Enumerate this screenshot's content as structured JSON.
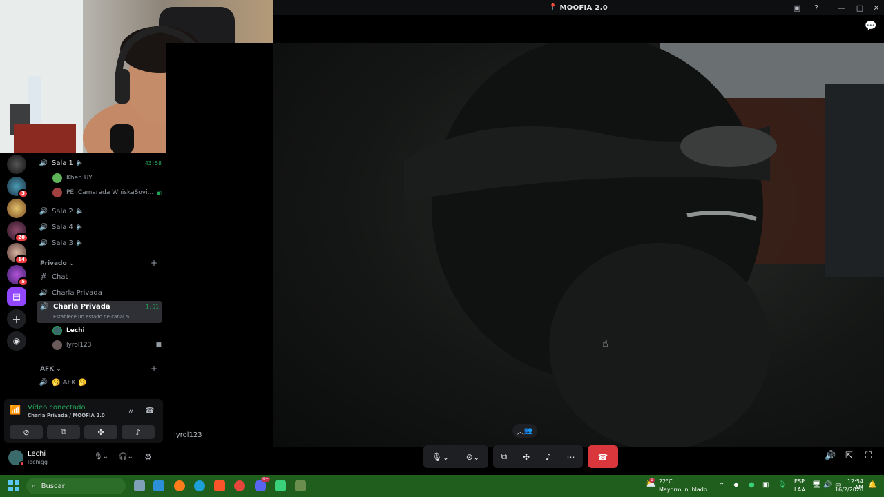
{
  "window": {
    "title": "MOOFIA 2.0"
  },
  "servers": [
    {
      "name": "server-1",
      "badge": ""
    },
    {
      "name": "server-2",
      "badge": "3"
    },
    {
      "name": "server-3",
      "badge": ""
    },
    {
      "name": "server-4",
      "badge": "20"
    },
    {
      "name": "server-5",
      "badge": "14"
    },
    {
      "name": "server-6",
      "badge": "5"
    },
    {
      "name": "twitch-server",
      "badge": ""
    }
  ],
  "channels": {
    "sala1": {
      "label": "Sala 1",
      "timer": "43:58",
      "members": [
        "Khen UY",
        "PE. Camarada WhiskaSovi..."
      ]
    },
    "sala2": {
      "label": "Sala 2"
    },
    "sala4": {
      "label": "Sala 4"
    },
    "sala3": {
      "label": "Sala 3"
    },
    "category_privado": "Privado",
    "chat": {
      "label": "Chat"
    },
    "charla1": {
      "label": "Charla Privada"
    },
    "charla2": {
      "label": "Charla Privada",
      "timer": "1:51",
      "status": "Establece un estado de canal",
      "members": [
        "Lechi",
        "lyrol123"
      ]
    },
    "category_afk": "AFK",
    "afk": {
      "label": "🥱 AFK 🥱"
    }
  },
  "voice": {
    "status": "Vídeo conectado",
    "channel": "Charla Privada / MOOFIA 2.0"
  },
  "user": {
    "name": "Lechi",
    "tag": "lechigg"
  },
  "video": {
    "participant": "lyrol123"
  },
  "taskbar": {
    "search_placeholder": "Buscar",
    "weather_temp": "22°C",
    "weather_desc": "Mayorm. nublado",
    "weather_badge": "1",
    "discord_badge": "9+",
    "lang1": "ESP",
    "lang2": "LAA",
    "time": "12:54 AM",
    "date": "16/2/2026"
  },
  "colors": {
    "accent": "#23a55a",
    "hangup": "#da373c",
    "taskbar": "#1f5e1d"
  }
}
